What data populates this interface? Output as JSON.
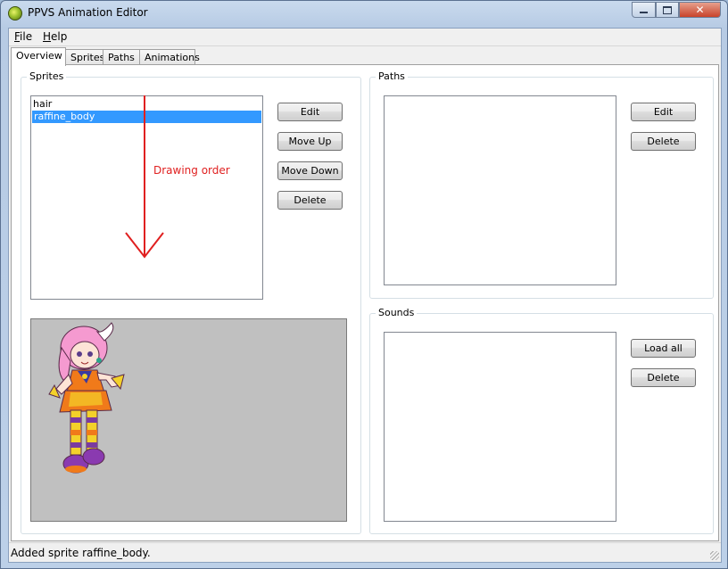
{
  "window": {
    "title": "PPVS Animation Editor"
  },
  "menu": {
    "file_underline": "F",
    "file_rest": "ile",
    "help_underline": "H",
    "help_rest": "elp"
  },
  "tabs": [
    {
      "label": "Overview"
    },
    {
      "label": "Sprites"
    },
    {
      "label": "Paths"
    },
    {
      "label": "Animations"
    }
  ],
  "sprites": {
    "title": "Sprites",
    "items": [
      {
        "label": "hair"
      },
      {
        "label": "raffine_body"
      }
    ],
    "selected_index": 1,
    "buttons": {
      "edit": "Edit",
      "move_up": "Move Up",
      "move_down": "Move Down",
      "delete": "Delete"
    },
    "annotation": "Drawing order"
  },
  "paths": {
    "title": "Paths",
    "buttons": {
      "edit": "Edit",
      "delete": "Delete"
    }
  },
  "sounds": {
    "title": "Sounds",
    "buttons": {
      "load_all": "Load all",
      "delete": "Delete"
    }
  },
  "status": {
    "text": "Added sprite raffine_body."
  },
  "colors": {
    "selection": "#3399ff",
    "annotation_red": "#e02020",
    "preview_bg": "#c0c0c0"
  }
}
